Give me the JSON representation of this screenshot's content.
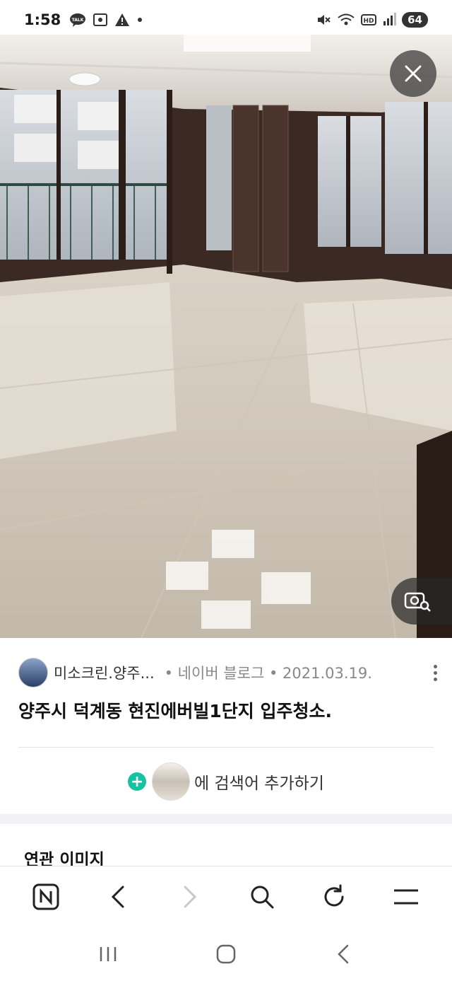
{
  "status_bar": {
    "time": "1:58",
    "battery": "64",
    "left_icons": [
      "kakaotalk-icon",
      "screenshot-icon",
      "alert-icon",
      "dot-icon"
    ],
    "right_icons": [
      "mute-icon",
      "wifi-icon",
      "hd-icon",
      "signal-icon"
    ]
  },
  "viewer": {
    "close_icon": "close-icon",
    "lens_icon": "image-search-icon"
  },
  "source": {
    "name": "미소크린.양주...",
    "meta": "• 네이버 블로그 • 2021.03.19."
  },
  "title": "양주시 덕계동 현진에버빌1단지 입주청소.",
  "add_search": {
    "text": "에 검색어 추가하기"
  },
  "related": {
    "heading": "연관 이미지"
  },
  "browser_nav": [
    "naver-home-icon",
    "back-icon",
    "forward-icon",
    "search-icon",
    "refresh-icon",
    "menu-icon"
  ],
  "colors": {
    "accent": "#16c2a0"
  }
}
